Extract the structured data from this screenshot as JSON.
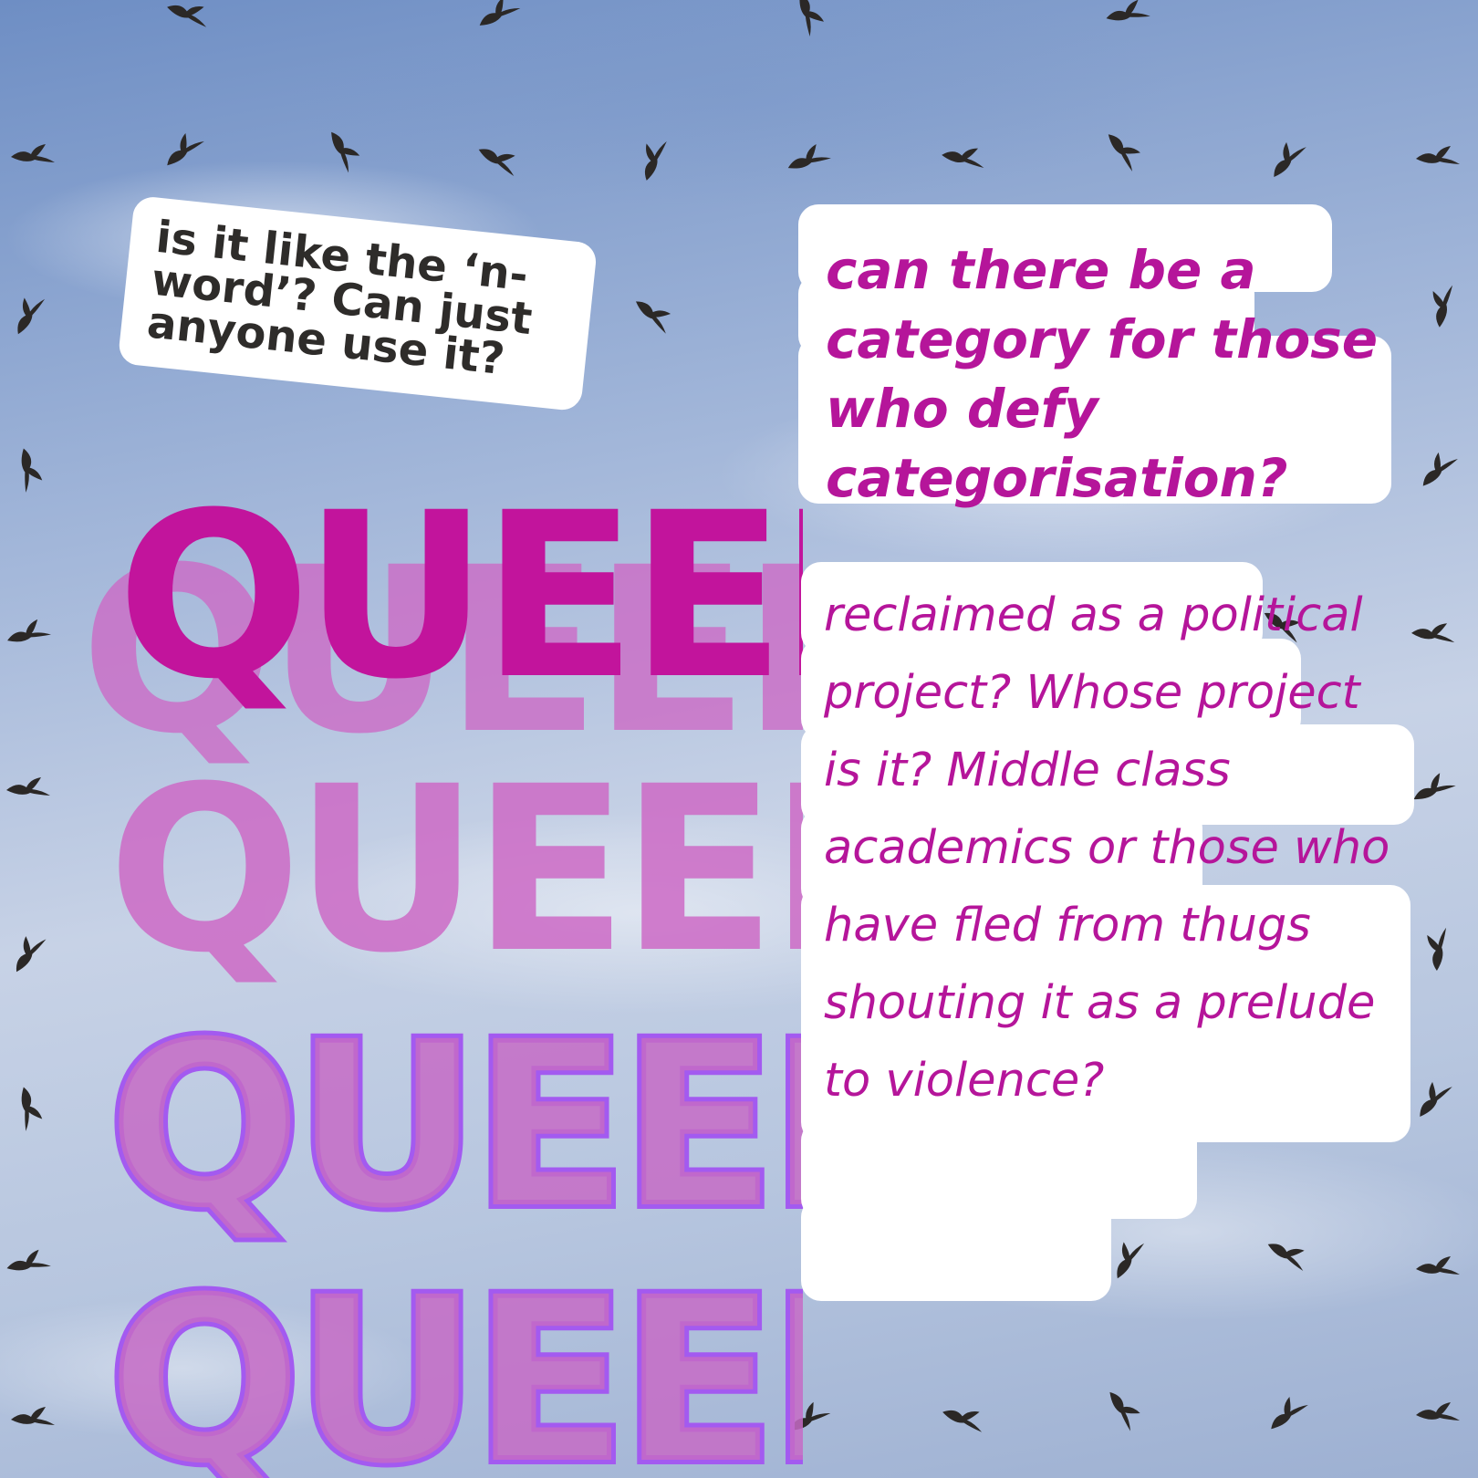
{
  "poster": {
    "note_question": "is it like the ‘n-word’? Can just anyone use it?",
    "category_question": "can there be a category for those who defy categorisation?",
    "reclaimed_question": "reclaimed as a political project? Whose project is it? Middle class academics or those who have fled from thugs shouting it as a prelude to violence?",
    "queer_word": "QUEER*",
    "queer_repeats": [
      "QUEER*",
      "QUEER*",
      "QUEER*",
      "QUEER*"
    ]
  },
  "colors": {
    "magenta": "#c2149c",
    "pink_echo": "#cc6ac6",
    "violet_outline": "#a35af0",
    "note_text": "#2e2c2a",
    "question_text": "#b5159a"
  },
  "background": "sky-with-flying-starlings"
}
